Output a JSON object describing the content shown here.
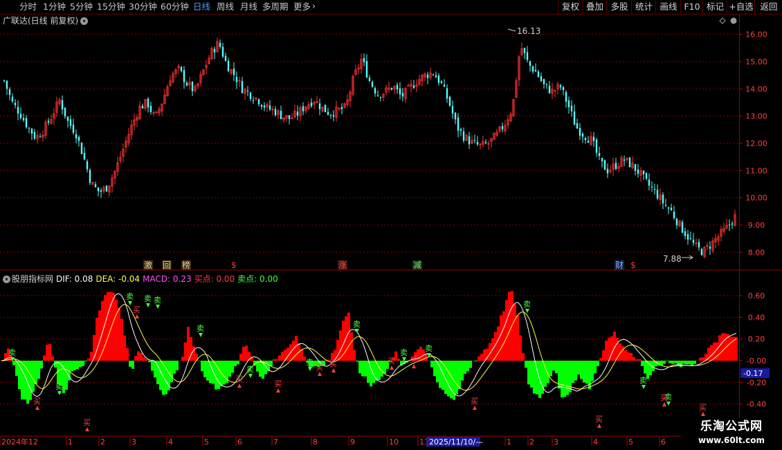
{
  "toolbar": {
    "periods": [
      "分时",
      "1分钟",
      "5分钟",
      "15分钟",
      "30分钟",
      "60分钟",
      "日线",
      "周线",
      "月线",
      "多周期",
      "更多"
    ],
    "active_period": "日线",
    "buttons": [
      "复权",
      "叠加",
      "多股",
      "统计",
      "画线",
      "F10",
      "标记",
      "+自选",
      "返回"
    ]
  },
  "upper_panel": {
    "title": "广联达(日线 前复权)",
    "high_label": "16.13",
    "low_label": "7.88",
    "y_ticks": [
      "16.00",
      "15.00",
      "14.00",
      "13.00",
      "12.00",
      "11.00",
      "10.00",
      "9.00",
      "8.00"
    ],
    "event_tags": [
      {
        "text": "激",
        "color": "#e8d4a0",
        "bg": "#3a2a10"
      },
      {
        "text": "回",
        "color": "#e8d4a0",
        "bg": "#3a2a10"
      },
      {
        "text": "榜",
        "color": "#e8d4a0",
        "bg": "#3a2a10"
      },
      {
        "text": "$",
        "color": "#ff3030",
        "bg": "#000"
      },
      {
        "text": "涨",
        "color": "#ff5050",
        "bg": "#401010"
      },
      {
        "text": "减",
        "color": "#7fe07f",
        "bg": "#103010"
      },
      {
        "text": "财",
        "color": "#7fb0ff",
        "bg": "#102040"
      },
      {
        "text": "$",
        "color": "#ff3030",
        "bg": "#000"
      }
    ]
  },
  "lower_panel": {
    "indicator_name": "股朋指标网",
    "dif": "DIF: 0.08",
    "dea": "DEA: -0.04",
    "macd": "MACD: 0.23",
    "buy": "买点: 0.00",
    "sell": "卖点: 0.00",
    "y_ticks": [
      "0.60",
      "0.40",
      "0.20",
      "-0.00",
      "-0.20",
      "-0.40"
    ],
    "current_value": "-0.17",
    "sell_label": "卖",
    "buy_label": "买"
  },
  "x_axis": {
    "labels": [
      "2024年12",
      "1",
      "2",
      "3",
      "4",
      "5",
      "6",
      "7",
      "8",
      "9",
      "10",
      "11",
      "2025/11/10/—",
      "1",
      "2",
      "3",
      "4",
      "5",
      "6"
    ]
  },
  "watermark": {
    "title": "乐淘公式网",
    "url": "www.60lt.com"
  },
  "colors": {
    "up": "#ff3232",
    "down": "#54ffff",
    "macd_pos": "#ff0000",
    "macd_neg": "#00ff00",
    "dif": "#ffffff",
    "dea": "#ffff50",
    "grid": "#8a0000",
    "active": "#4a9cff"
  },
  "chart_data": {
    "type": "candlestick",
    "price_range": [
      7.6,
      16.5
    ],
    "close_series": [
      14.3,
      13.5,
      13.1,
      12.6,
      12.2,
      12.5,
      13.0,
      13.6,
      12.8,
      12.4,
      11.5,
      10.5,
      10.2,
      10.4,
      11.0,
      11.8,
      12.6,
      13.3,
      13.5,
      12.9,
      13.6,
      14.5,
      14.7,
      14.2,
      13.9,
      14.6,
      15.3,
      15.7,
      14.9,
      14.5,
      14.0,
      13.8,
      13.6,
      13.3,
      13.2,
      13.0,
      12.9,
      13.1,
      13.4,
      13.6,
      13.3,
      13.1,
      13.2,
      13.3,
      14.4,
      15.1,
      14.3,
      13.8,
      13.9,
      14.1,
      13.7,
      14.0,
      14.3,
      14.5,
      14.6,
      14.2,
      13.5,
      12.6,
      12.2,
      12.0,
      11.9,
      12.0,
      12.3,
      12.7,
      13.3,
      15.6,
      14.9,
      14.6,
      14.1,
      13.9,
      14.1,
      13.4,
      12.6,
      12.3,
      12.1,
      11.3,
      11.0,
      11.2,
      11.4,
      11.2,
      10.9,
      10.5,
      10.2,
      9.8,
      9.5,
      9.0,
      8.6,
      8.2,
      8.0,
      8.3,
      8.6,
      8.9,
      9.3
    ]
  }
}
